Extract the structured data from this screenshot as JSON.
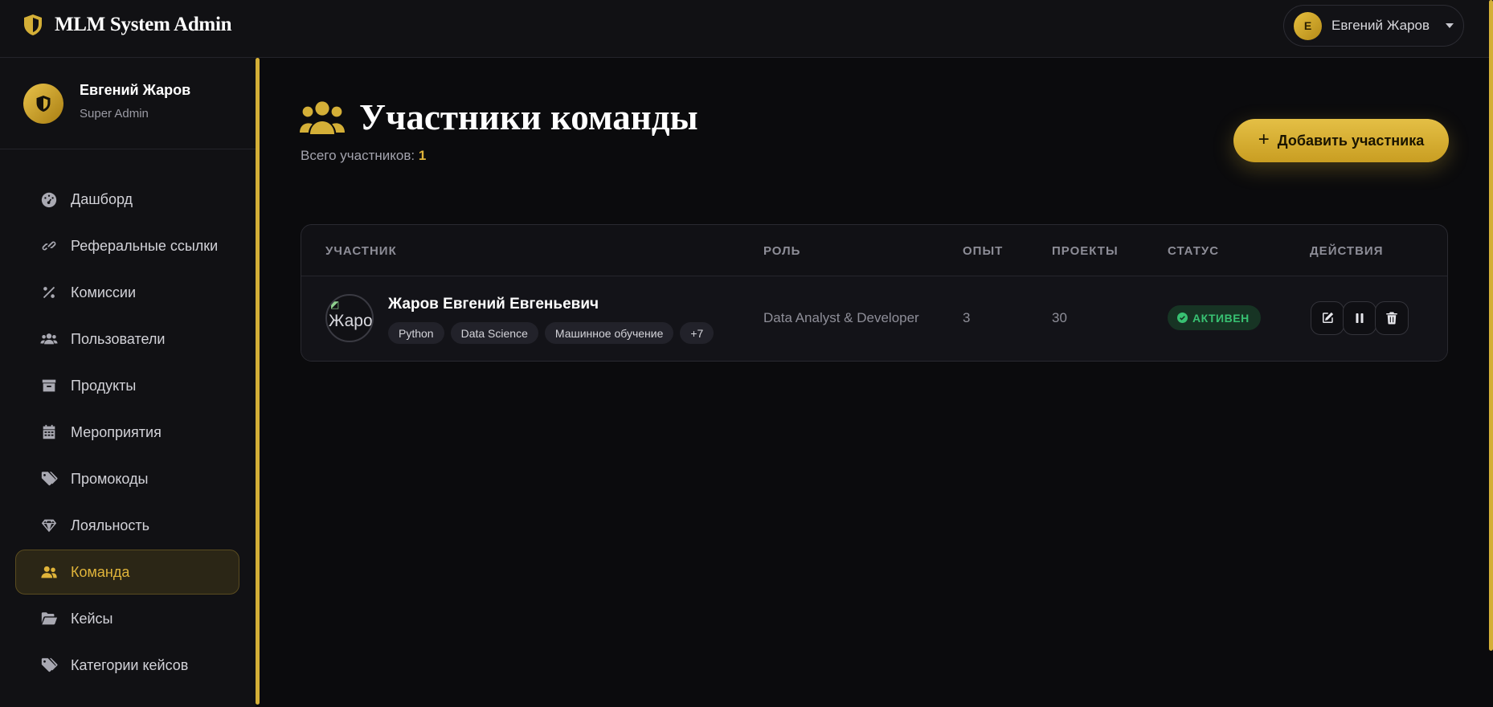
{
  "app": {
    "title": "MLM System Admin"
  },
  "header": {
    "user_initial": "Е",
    "user_name": "Евгений Жаров"
  },
  "sidebar": {
    "profile": {
      "name": "Евгений Жаров",
      "role": "Super Admin"
    },
    "items": [
      {
        "label": "Дашборд",
        "icon": "dashboard-icon",
        "active": false
      },
      {
        "label": "Реферальные ссылки",
        "icon": "link-icon",
        "active": false
      },
      {
        "label": "Комиссии",
        "icon": "percent-icon",
        "active": false
      },
      {
        "label": "Пользователи",
        "icon": "users-icon",
        "active": false
      },
      {
        "label": "Продукты",
        "icon": "box-icon",
        "active": false
      },
      {
        "label": "Мероприятия",
        "icon": "calendar-icon",
        "active": false
      },
      {
        "label": "Промокоды",
        "icon": "tags-icon",
        "active": false
      },
      {
        "label": "Лояльность",
        "icon": "gem-icon",
        "active": false
      },
      {
        "label": "Команда",
        "icon": "team-icon",
        "active": true
      },
      {
        "label": "Кейсы",
        "icon": "folder-open-icon",
        "active": false
      },
      {
        "label": "Категории кейсов",
        "icon": "tags-icon",
        "active": false
      }
    ]
  },
  "main": {
    "title": "Участники команды",
    "subtitle_label": "Всего участников:",
    "subtitle_count": "1",
    "add_button_label": "Добавить участника",
    "table": {
      "headers": {
        "member": "УЧАСТНИК",
        "role": "РОЛЬ",
        "experience": "ОПЫТ",
        "projects": "ПРОЕКТЫ",
        "status": "СТАТУС",
        "actions": "ДЕЙСТВИЯ"
      },
      "rows": [
        {
          "avatar_alt": "Жаров",
          "name": "Жаров Евгений Евгеньевич",
          "tags": [
            "Python",
            "Data Science",
            "Машинное обучение",
            "+7"
          ],
          "role": "Data Analyst & Developer",
          "experience": "3",
          "projects": "30",
          "status": "АКТИВЕН"
        }
      ]
    }
  },
  "colors": {
    "accent": "#d4af37",
    "background": "#0b0b0d",
    "panel": "#111114",
    "status_active": "#38c172"
  }
}
